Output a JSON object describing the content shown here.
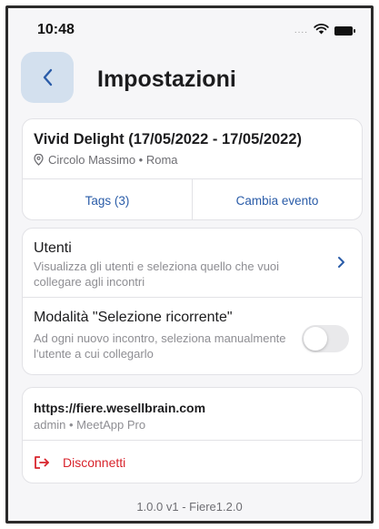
{
  "status_bar": {
    "time": "10:48",
    "signal": "....",
    "icons": [
      "wifi-icon",
      "battery-icon"
    ]
  },
  "header": {
    "title": "Impostazioni",
    "back_icon": "chevron-left-icon"
  },
  "event": {
    "title": "Vivid Delight (17/05/2022 - 17/05/2022)",
    "location": "Circolo Massimo • Roma",
    "location_icon": "location-pin-icon",
    "tags_label": "Tags (3)",
    "change_label": "Cambia evento"
  },
  "settings": {
    "users": {
      "title": "Utenti",
      "description": "Visualizza gli utenti e seleziona quello che vuoi collegare agli incontri",
      "icon": "chevron-right-icon"
    },
    "recurring_mode": {
      "title": "Modalità \"Selezione ricorrente\"",
      "description": "Ad ogni nuovo incontro, seleziona manualmente l'utente a cui collegarlo",
      "enabled": false
    }
  },
  "account": {
    "url": "https://fiere.wesellbrain.com",
    "subtitle": "admin • MeetApp Pro",
    "logout_label": "Disconnetti",
    "logout_icon": "logout-icon"
  },
  "version": "1.0.0 v1 - Fiere1.2.0",
  "colors": {
    "accent": "#2a5ca8",
    "danger": "#d8242c",
    "back_button_bg": "#d3e0ee",
    "background": "#f6f6f8"
  }
}
